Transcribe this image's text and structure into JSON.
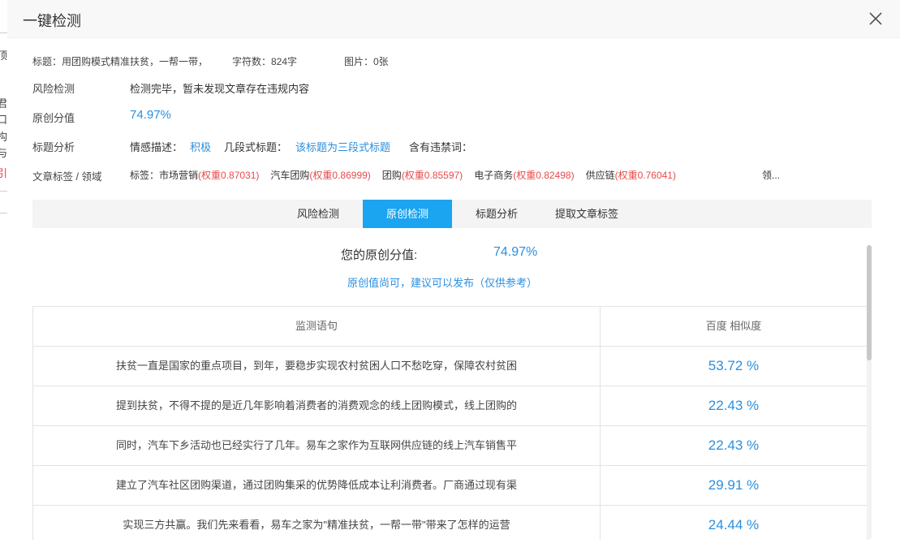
{
  "dialog": {
    "title": "一键检测"
  },
  "meta": {
    "title_text": "标题：用团购模式精准扶贫，一帮一带，",
    "char_count": "字符数：824字",
    "images": "图片：0张"
  },
  "summary": {
    "risk_label": "风险检测",
    "risk_value": "检测完毕，暂未发现文章存在违规内容",
    "original_label": "原创分值",
    "original_value": "74.97%",
    "title_label": "标题分析",
    "sentiment_label": "情感描述：",
    "sentiment_value": "积极",
    "segment_label": "几段式标题：",
    "segment_value": "该标题为三段式标题",
    "banned_label": "含有违禁词：",
    "tags_label": "文章标签 / 领域",
    "tags_prefix": "标签：",
    "tags": [
      {
        "name": "市场营销",
        "weight": "(权重0.87031)"
      },
      {
        "name": "汽车团购",
        "weight": "(权重0.86999)"
      },
      {
        "name": "团购",
        "weight": "(权重0.85597)"
      },
      {
        "name": "电子商务",
        "weight": "(权重0.82498)"
      },
      {
        "name": "供应链",
        "weight": "(权重0.76041)"
      }
    ],
    "tags_more": "领..."
  },
  "tabs": [
    "风险检测",
    "原创检测",
    "标题分析",
    "提取文章标签"
  ],
  "active_tab": 1,
  "originality": {
    "score_label": "您的原创分值:",
    "score_value": "74.97%",
    "advice": "原创值尚可，建议可以发布（仅供参考）",
    "col_sentence": "监测语句",
    "col_similarity": "百度 相似度",
    "rows": [
      {
        "sentence": "扶贫一直是国家的重点项目，到年，要稳步实现农村贫困人口不愁吃穿，保障农村贫困",
        "similarity": "53.72 %"
      },
      {
        "sentence": "提到扶贫，不得不提的是近几年影响着消费者的消费观念的线上团购模式，线上团购的",
        "similarity": "22.43 %"
      },
      {
        "sentence": "同时，汽车下乡活动也已经实行了几年。易车之家作为互联网供应链的线上汽车销售平",
        "similarity": "22.43 %"
      },
      {
        "sentence": "建立了汽车社区团购渠道，通过团购集采的优势降低成本让利消费者。厂商通过现有渠",
        "similarity": "29.91 %"
      },
      {
        "sentence": "实现三方共赢。我们先来看看，易车之家为\"精准扶贫，一帮一带\"带来了怎样的运营",
        "similarity": "24.44 %"
      }
    ]
  },
  "background_chars": [
    "顶",
    "君",
    "口",
    "构",
    "与",
    "引"
  ],
  "colors": {
    "accent": "#1ba4f0",
    "link": "#2a8fe0",
    "weight": "#e84a4a"
  }
}
